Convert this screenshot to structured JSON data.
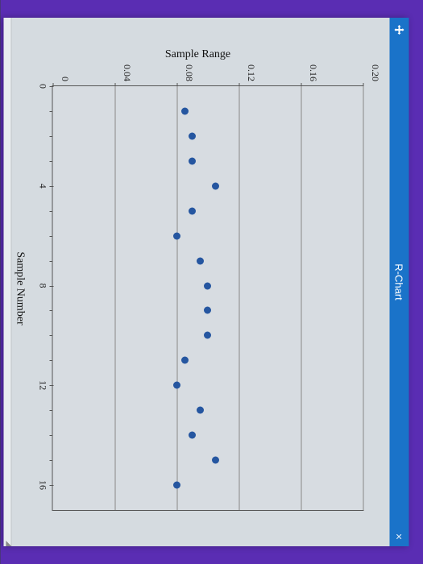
{
  "window": {
    "title": "R-Chart",
    "move_label": "Move",
    "close_label": "Close"
  },
  "chart_data": {
    "type": "scatter",
    "title": "",
    "xlabel": "Sample Number",
    "ylabel": "Sample Range",
    "xlim": [
      0,
      17
    ],
    "ylim": [
      0,
      0.2
    ],
    "x_ticks_major": [
      0,
      4,
      8,
      12,
      16
    ],
    "x_ticks_minor": [
      1,
      2,
      3,
      5,
      6,
      7,
      9,
      10,
      11,
      13,
      14,
      15
    ],
    "y_ticks": [
      0,
      0.04,
      0.08,
      0.12,
      0.16,
      0.2
    ],
    "y_tick_labels": [
      "0",
      "0.04",
      "0.08",
      "0.12",
      "0.16",
      "0.20"
    ],
    "series": [
      {
        "name": "Sample Range",
        "x": [
          1,
          2,
          3,
          4,
          5,
          6,
          7,
          8,
          9,
          10,
          11,
          12,
          13,
          14,
          15,
          16
        ],
        "y": [
          0.085,
          0.09,
          0.09,
          0.105,
          0.09,
          0.08,
          0.095,
          0.1,
          0.1,
          0.1,
          0.085,
          0.08,
          0.095,
          0.09,
          0.105,
          0.08
        ]
      }
    ]
  }
}
